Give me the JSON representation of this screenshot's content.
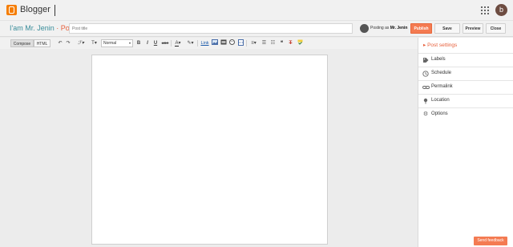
{
  "topbar": {
    "app_name": "Blogger",
    "avatar_letter": "b"
  },
  "header": {
    "blog_name": "I'am Mr. Jenin",
    "separator": " · ",
    "section": "Post",
    "title_placeholder": "Post title",
    "posting_as_prefix": "Posting as ",
    "posting_as_user": "Mr. Jenin",
    "publish_label": "Publish",
    "save_label": "Save",
    "preview_label": "Preview",
    "close_label": "Close"
  },
  "toolbar": {
    "compose_label": "Compose",
    "html_label": "HTML",
    "format_select_value": "Normal",
    "undo_glyph": "↶",
    "redo_glyph": "↷",
    "font_glyph": "ℱ",
    "fontsize_glyph": "T",
    "bold_glyph": "B",
    "italic_glyph": "I",
    "underline_glyph": "U",
    "strike_glyph": "ABC",
    "link_label": "Link",
    "quote_glyph": "❝",
    "remove_format_glyph": "T"
  },
  "post_settings": {
    "heading": "Post settings",
    "items": [
      {
        "label": "Labels",
        "icon": "tag-icon"
      },
      {
        "label": "Schedule",
        "icon": "clock-icon"
      },
      {
        "label": "Permalink",
        "icon": "link-icon"
      },
      {
        "label": "Location",
        "icon": "pin-icon"
      },
      {
        "label": "Options",
        "icon": "gear-icon"
      }
    ]
  },
  "feedback_label": "Send feedback",
  "colors": {
    "accent_orange": "#f47b52",
    "blog_name_teal": "#3a8d9a",
    "logo_orange": "#f57d00"
  }
}
